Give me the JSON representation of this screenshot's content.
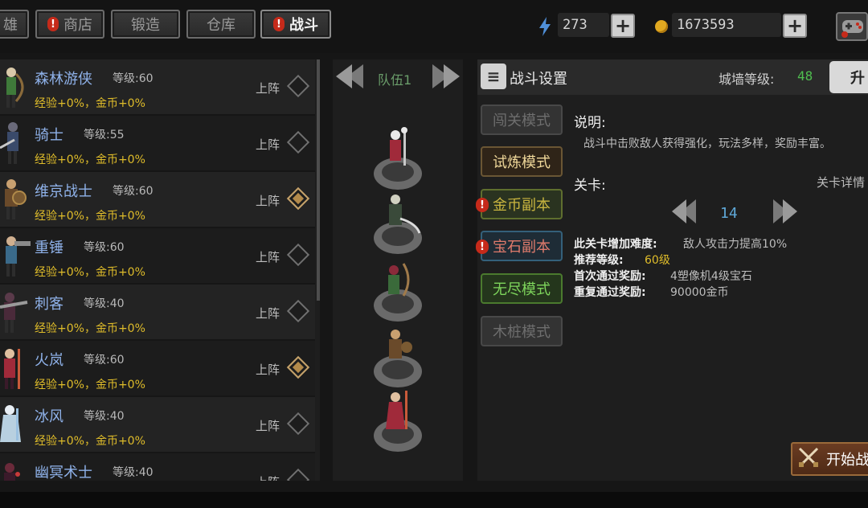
{
  "tabs": [
    {
      "label": "雄",
      "active": false,
      "alert": false
    },
    {
      "label": "商店",
      "active": false,
      "alert": true
    },
    {
      "label": "锻造",
      "active": false,
      "alert": false
    },
    {
      "label": "仓库",
      "active": false,
      "alert": false
    },
    {
      "label": "战斗",
      "active": true,
      "alert": true
    }
  ],
  "resources": {
    "energy": {
      "icon": "lightning-icon",
      "value": "273"
    },
    "gold": {
      "icon": "coin-icon",
      "value": "1673593"
    }
  },
  "heroes": [
    {
      "name": "森林游侠",
      "level_text": "等级:60",
      "bonus": "经验+0%，金币+0%",
      "deploy_label": "上阵",
      "deployed": false
    },
    {
      "name": "骑士",
      "level_text": "等级:55",
      "bonus": "经验+0%，金币+0%",
      "deploy_label": "上阵",
      "deployed": false
    },
    {
      "name": "维京战士",
      "level_text": "等级:60",
      "bonus": "经验+0%，金币+0%",
      "deploy_label": "上阵",
      "deployed": true
    },
    {
      "name": "重锤",
      "level_text": "等级:60",
      "bonus": "经验+0%，金币+0%",
      "deploy_label": "上阵",
      "deployed": false
    },
    {
      "name": "刺客",
      "level_text": "等级:40",
      "bonus": "经验+0%，金币+0%",
      "deploy_label": "上阵",
      "deployed": false
    },
    {
      "name": "火岚",
      "level_text": "等级:60",
      "bonus": "经验+0%，金币+0%",
      "deploy_label": "上阵",
      "deployed": true
    },
    {
      "name": "冰风",
      "level_text": "等级:40",
      "bonus": "经验+0%，金币+0%",
      "deploy_label": "上阵",
      "deployed": false
    },
    {
      "name": "幽冥术士",
      "level_text": "等级:40",
      "bonus": "",
      "deploy_label": "上阵",
      "deployed": false
    }
  ],
  "team": {
    "label": "队伍1"
  },
  "panel": {
    "title": "战斗设置",
    "wall_label": "城墙等级:",
    "wall_value": "48",
    "upgrade_label": "升",
    "modes": [
      {
        "label": "闯关模式",
        "style": "gray",
        "alert": false
      },
      {
        "label": "试炼模式",
        "style": "trial",
        "alert": false
      },
      {
        "label": "金币副本",
        "style": "gold",
        "alert": true
      },
      {
        "label": "宝石副本",
        "style": "gem",
        "alert": true
      },
      {
        "label": "无尽模式",
        "style": "endless",
        "alert": false
      },
      {
        "label": "木桩模式",
        "style": "gray",
        "alert": false
      }
    ],
    "desc_title": "说明:",
    "desc_text": "战斗中击败敌人获得强化，玩法多样，奖励丰富。",
    "stage_label": "关卡:",
    "stage_detail": "关卡详情",
    "stage_number": "14",
    "info": [
      {
        "key": "此关卡增加难度:",
        "value": "敌人攻击力提高10%",
        "highlight": false
      },
      {
        "key": "推荐等级:",
        "value": "60级",
        "highlight": true
      },
      {
        "key": "首次通过奖励:",
        "value": "4塑像机4级宝石",
        "highlight": false
      },
      {
        "key": "重复通过奖励:",
        "value": "90000金币",
        "highlight": false
      }
    ],
    "start_label": "开始战"
  },
  "colors": {
    "hero_name": "#8fb2ea",
    "bonus": "#e0bd2a",
    "wall_level": "#4fbf4f",
    "stage_number": "#5fa8d8"
  }
}
